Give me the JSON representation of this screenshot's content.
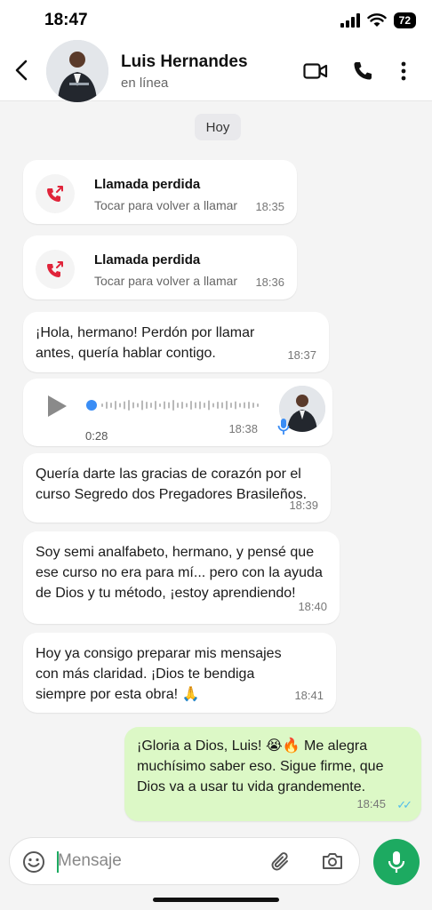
{
  "status_bar": {
    "time": "18:47",
    "battery": "72"
  },
  "header": {
    "contact_name": "Luis Hernandes",
    "contact_status": "en línea"
  },
  "chat": {
    "date_chip": "Hoy",
    "missed_calls": [
      {
        "title": "Llamada perdida",
        "subtitle": "Tocar para volver a llamar",
        "time": "18:35"
      },
      {
        "title": "Llamada perdida",
        "subtitle": "Tocar para volver a llamar",
        "time": "18:36"
      }
    ],
    "messages": [
      {
        "line1": "¡Hola, hermano! Perdón por llamar",
        "line2": "antes, quería hablar contigo.",
        "time": "18:37"
      },
      {
        "line1": "Quería darte las gracias de corazón por el",
        "line2": "curso Segredo dos Pregadores Brasileños.",
        "time": "18:39"
      },
      {
        "line1": "Soy semi analfabeto, hermano, y pensé que",
        "line2": "ese curso no era para mí... pero con la ayuda",
        "line3": "de Dios y tu método, ¡estoy aprendiendo!",
        "time": "18:40"
      },
      {
        "line1": "Hoy ya consigo preparar mis mensajes",
        "line2": "con más claridad. ¡Dios te bendiga",
        "line3": "siempre por esta obra! 🙏",
        "time": "18:41"
      }
    ],
    "voice_note": {
      "duration": "0:28",
      "time": "18:38",
      "progress": 0
    },
    "outgoing": {
      "line1": "¡Gloria a Dios, Luis! 😭🔥  Me alegra",
      "line2": "muchísimo saber eso. Sigue firme, que",
      "line3": "Dios va a usar tu vida grandemente.",
      "time": "18:45",
      "read": "✓✓"
    }
  },
  "input": {
    "placeholder": "Mensaje"
  },
  "colors": {
    "accent": "#1daa61",
    "missed_call": "#e0243a",
    "read_ticks": "#53bdeb",
    "outgoing_bubble": "#dcf8c6"
  },
  "icons": [
    "back-arrow-icon",
    "video-call-icon",
    "phone-icon",
    "more-icon",
    "missed-call-icon",
    "play-icon",
    "mic-icon",
    "emoji-icon",
    "attach-icon",
    "camera-icon"
  ]
}
